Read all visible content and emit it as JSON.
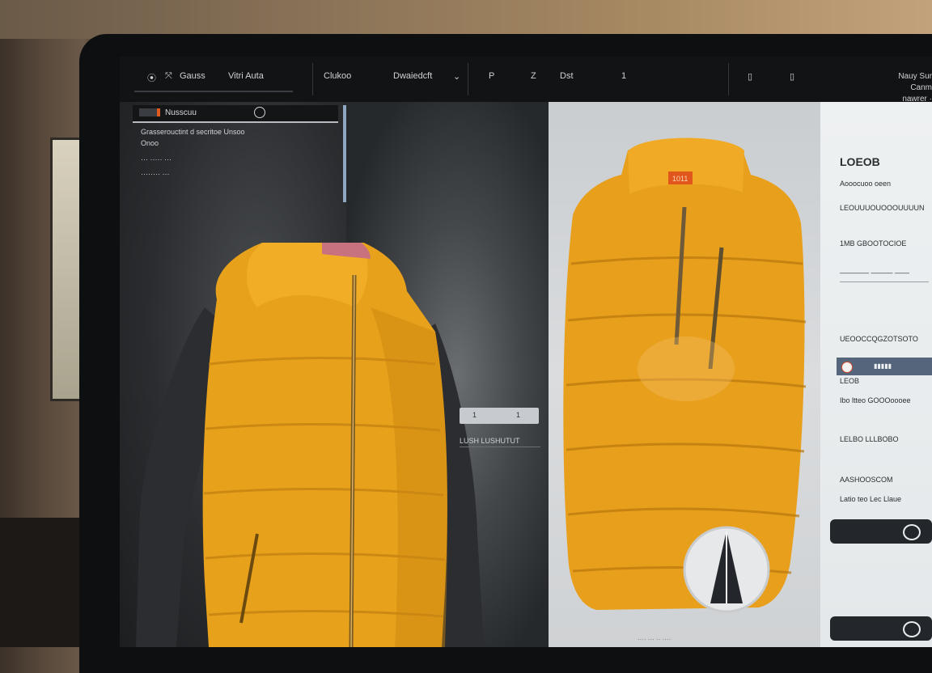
{
  "toolbar": {
    "items": [
      "Gauss",
      "Vitri Auta",
      "Clukoo",
      "Dwaiedcft",
      "P",
      "Z",
      "Dst",
      "1"
    ],
    "right_stack": [
      "Nauy Sur",
      "Canm",
      "nawrer ·"
    ]
  },
  "left_panel": {
    "title": "Nusscuu",
    "lines": [
      "Grasserouctint d secritoe Unsoo",
      "Onoo",
      "··· ····· ···",
      "········ ···"
    ]
  },
  "viewport_controls": {
    "box": [
      "1",
      "1"
    ],
    "label": "LUSH LUSHUTUT"
  },
  "product_image": {
    "tag_text": "1011",
    "footer": "···· ··· ·· ····"
  },
  "info_panel": {
    "heading": "LOEOB",
    "subheading": "Aooocuoo oeen",
    "lines": [
      "LEOUUUOUOOOUUUUN",
      "1MB GBOOTOCIOE",
      "———— ——— ——",
      "UEOOCCQGZOTSOTO",
      "LEOB",
      "Ibo ltteo GOOOoooee",
      "LELBO LLLBOBO",
      "AASHOOSCOM",
      "Latio teo Lec Llaue"
    ],
    "colors": {
      "primary_button": "#23262a",
      "accent_bar": "#55657c"
    }
  }
}
